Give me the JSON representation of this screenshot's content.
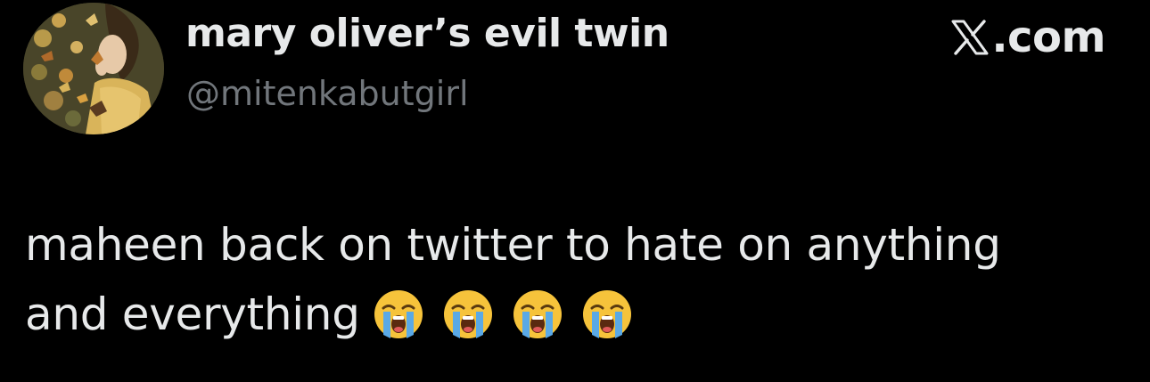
{
  "author": {
    "display_name": "mary oliver’s evil twin",
    "handle": "@mitenkabutgirl",
    "avatar_icon": "avatar-painting-butterflies"
  },
  "brand": {
    "icon": "x-logo-icon",
    "label": ".com"
  },
  "tweet": {
    "line1": "maheen back on twitter to hate on anything",
    "line2": "and everything",
    "emojis": [
      "loudly-crying-face-icon",
      "loudly-crying-face-icon",
      "loudly-crying-face-icon",
      "loudly-crying-face-icon"
    ]
  },
  "colors": {
    "background": "#000000",
    "text_primary": "#e7e9ea",
    "text_secondary": "#71767b",
    "emoji_face": "#f6c33b",
    "emoji_tears": "#5aa9e6"
  }
}
